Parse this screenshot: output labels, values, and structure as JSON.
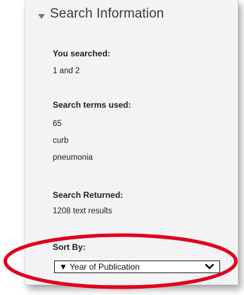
{
  "panel": {
    "title": "Search Information"
  },
  "you_searched": {
    "label": "You searched:",
    "value": "1 and 2"
  },
  "search_terms": {
    "label": "Search terms used:",
    "terms": [
      "65",
      "curb",
      "pneumonia"
    ]
  },
  "search_returned": {
    "label": "Search Returned:",
    "value": "1208 text results"
  },
  "sort_by": {
    "label": "Sort By:",
    "selected": "▼ Year of Publication"
  },
  "colors": {
    "highlight": "#e0001b",
    "panel_bg": "#f3f3f3"
  },
  "icons": {
    "collapse": "caret-down-icon",
    "dropdown": "chevron-down-icon"
  }
}
